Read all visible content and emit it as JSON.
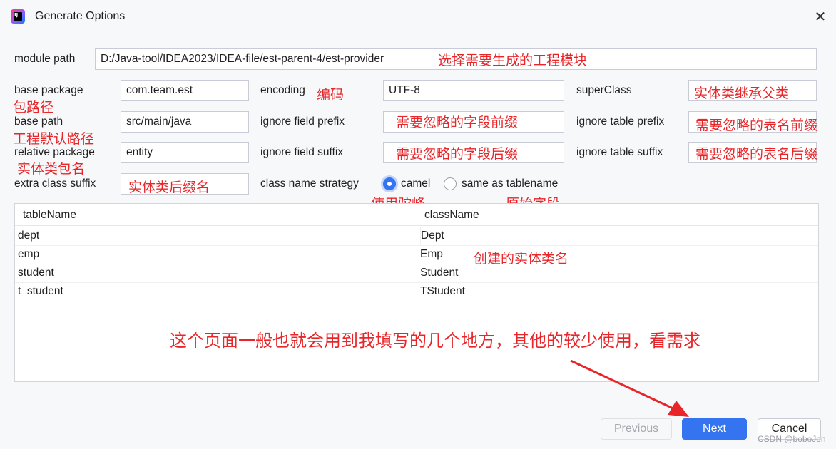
{
  "dialog": {
    "title": "Generate Options",
    "close_symbol": "✕",
    "app_icon_text": "IJ"
  },
  "module_path": {
    "label": "module path",
    "value": "D:/Java-tool/IDEA2023/IDEA-file/est-parent-4/est-provider"
  },
  "base_package": {
    "label": "base package",
    "value": "com.team.est"
  },
  "base_path": {
    "label": "base path",
    "value": "src/main/java"
  },
  "relative_package": {
    "label": "relative package",
    "value": "entity"
  },
  "extra_class_suffix": {
    "label": "extra class suffix",
    "value": ""
  },
  "encoding": {
    "label": "encoding",
    "value": "UTF-8"
  },
  "ignore_field_prefix": {
    "label": "ignore field prefix",
    "value": ""
  },
  "ignore_field_suffix": {
    "label": "ignore field suffix",
    "value": ""
  },
  "super_class": {
    "label": "superClass",
    "value": ""
  },
  "ignore_table_prefix": {
    "label": "ignore table prefix",
    "value": ""
  },
  "ignore_table_suffix": {
    "label": "ignore table suffix",
    "value": ""
  },
  "class_name_strategy": {
    "label": "class name strategy",
    "options": [
      {
        "label": "camel",
        "selected": true
      },
      {
        "label": "same as tablename",
        "selected": false
      }
    ]
  },
  "table": {
    "headers": [
      "tableName",
      "className"
    ],
    "rows": [
      [
        "dept",
        "Dept"
      ],
      [
        "emp",
        "Emp"
      ],
      [
        "student",
        "Student"
      ],
      [
        "t_student",
        "TStudent"
      ]
    ]
  },
  "annotations": {
    "module_path": "选择需要生成的工程模块",
    "base_package": "包路径",
    "base_path": "工程默认路径",
    "relative_package": "实体类包名",
    "extra_class_suffix": "实体类后缀名",
    "encoding": "编码",
    "ignore_field_prefix": "需要忽略的字段前缀",
    "ignore_field_suffix": "需要忽略的字段后缀",
    "super_class": "实体类继承父类",
    "ignore_table_prefix": "需要忽略的表名前缀",
    "ignore_table_suffix": "需要忽略的表名后缀",
    "camel": "使用驼峰",
    "same_as_tablename": "原始字段",
    "class_name": "创建的实体类名",
    "summary": "这个页面一般也就会用到我填写的几个地方，其他的较少使用，看需求"
  },
  "buttons": {
    "previous": "Previous",
    "next": "Next",
    "cancel": "Cancel"
  },
  "watermark": "CSDN @boboJon",
  "colors": {
    "accent": "#3574f0",
    "annotation": "#e8262a"
  }
}
